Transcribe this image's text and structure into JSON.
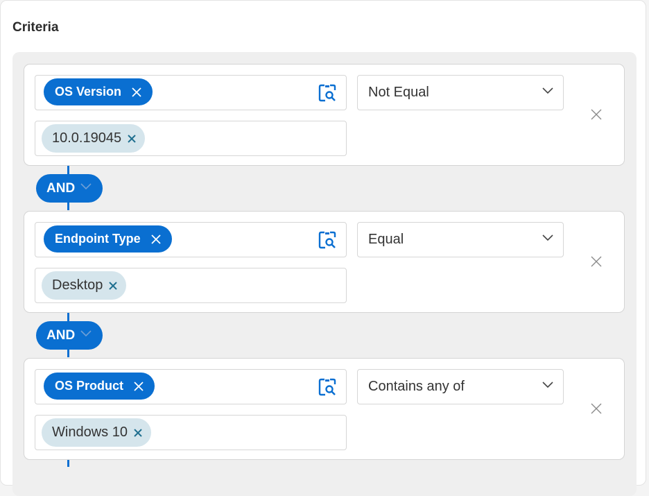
{
  "section": {
    "title": "Criteria"
  },
  "logic_operators": [
    {
      "label": "AND"
    },
    {
      "label": "AND"
    }
  ],
  "criteria": [
    {
      "field": "OS Version",
      "value": "10.0.19045",
      "operator": "Not Equal"
    },
    {
      "field": "Endpoint Type",
      "value": "Desktop",
      "operator": "Equal"
    },
    {
      "field": "OS Product",
      "value": "Windows 10",
      "operator": "Contains any of"
    }
  ],
  "icons": {
    "field_remove": "close-icon",
    "value_remove": "close-icon",
    "lookup": "lookup-icon",
    "dropdown": "chevron-down-icon",
    "row_remove": "close-icon"
  },
  "colors": {
    "accent": "#0a6fd1",
    "chip_bg": "#d5e5ec",
    "chip_x": "#1f6f8f",
    "group_bg": "#efefef"
  }
}
